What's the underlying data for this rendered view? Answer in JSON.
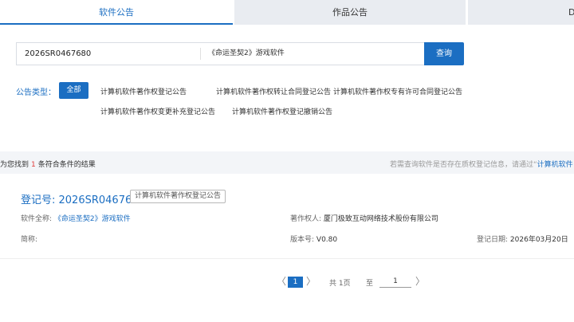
{
  "tabs": {
    "software": "软件公告",
    "works": "作品公告",
    "third": "D"
  },
  "search": {
    "reg_number": "2026SR0467680",
    "software_name": "《命运圣契2》游戏软件",
    "button": "查询"
  },
  "filter": {
    "label": "公告类型：",
    "all": "全部",
    "types": [
      "计算机软件著作权登记公告",
      "计算机软件著作权转让合同登记公告",
      "计算机软件著作权专有许可合同登记公告",
      "计算机软件著作权变更补充登记公告",
      "计算机软件著作权登记撤销公告"
    ]
  },
  "results": {
    "prefix": "为您找到",
    "count": "1",
    "suffix": "条符合条件的结果",
    "right_text": "若需查询软件是否存在质权登记信息，请通过“",
    "right_link": "计算机软件"
  },
  "record": {
    "reg_title": "登记号: 2026SR0467680",
    "badge": "计算机软件著作权登记公告",
    "fullname_label": "软件全称:",
    "fullname_value": "《命运圣契2》游戏软件",
    "owner_label": "著作权人:",
    "owner_value": "厦门极致互动网络技术股份有限公司",
    "abbr_label": "简称:",
    "abbr_value": "",
    "version_label": "版本号:",
    "version_value": "V0.80",
    "date_label": "登记日期:",
    "date_value": "2026年03月20日"
  },
  "pagination": {
    "prev": "〈",
    "current": "1",
    "next": "〉",
    "total": "共 1页",
    "goto_prefix": "至",
    "goto_value": "1",
    "go": "〉"
  }
}
